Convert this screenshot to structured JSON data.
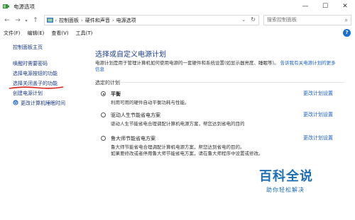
{
  "window": {
    "title": "电源选项",
    "controls": [
      "—",
      "☐",
      "✕"
    ]
  },
  "addressbar": {
    "breadcrumbs": [
      "控制面板",
      "硬件和声音",
      "电源选项"
    ],
    "search_placeholder": "搜索控制面板"
  },
  "menubar": [
    "文件(F)",
    "编辑(E)",
    "查看(V)",
    "工具(T)"
  ],
  "sidebar": {
    "items": [
      {
        "label": "控制面板主页"
      },
      {
        "label": "唤醒时需要密码"
      },
      {
        "label": "选择电源按钮的功能"
      },
      {
        "label": "选择关闭盖子的功能"
      },
      {
        "label": "创建电源计划"
      },
      {
        "label": "更改计算机睡眠时间"
      }
    ],
    "highlight_color": "#e0201a"
  },
  "main": {
    "heading": "选择或自定义电源计划",
    "description": "电源计划是用于管理计算机如何使用电源的一套硬件和系统设置(如显示器亮度、睡眠等)。",
    "description_link": "告诉我有关电源计划的更多信息",
    "section_label": "选定的计划",
    "plans": [
      {
        "name": "平衡",
        "desc": "利用可用的硬件自动平衡功耗与性能。",
        "change": "更改计划设置",
        "selected": true
      },
      {
        "name": "驱动人生节能省电方案",
        "desc": "驱动人生节能省电合理调配计算机电源方案，帮您达到省电的目的",
        "change": "更改计划设置",
        "selected": false
      },
      {
        "name": "鲁大师节能省电方案",
        "desc1": "鲁大师节能省电合理调配计算机电源方案，帮您达到省电的目的。",
        "desc2": "如果要修改或者停用鲁大师节能省电方案，请在鲁大师程序中设置或修改。",
        "change": "更改计划设置",
        "selected": false
      }
    ]
  },
  "watermark": {
    "title": "百科全说",
    "subtitle": "助你轻松解决"
  }
}
